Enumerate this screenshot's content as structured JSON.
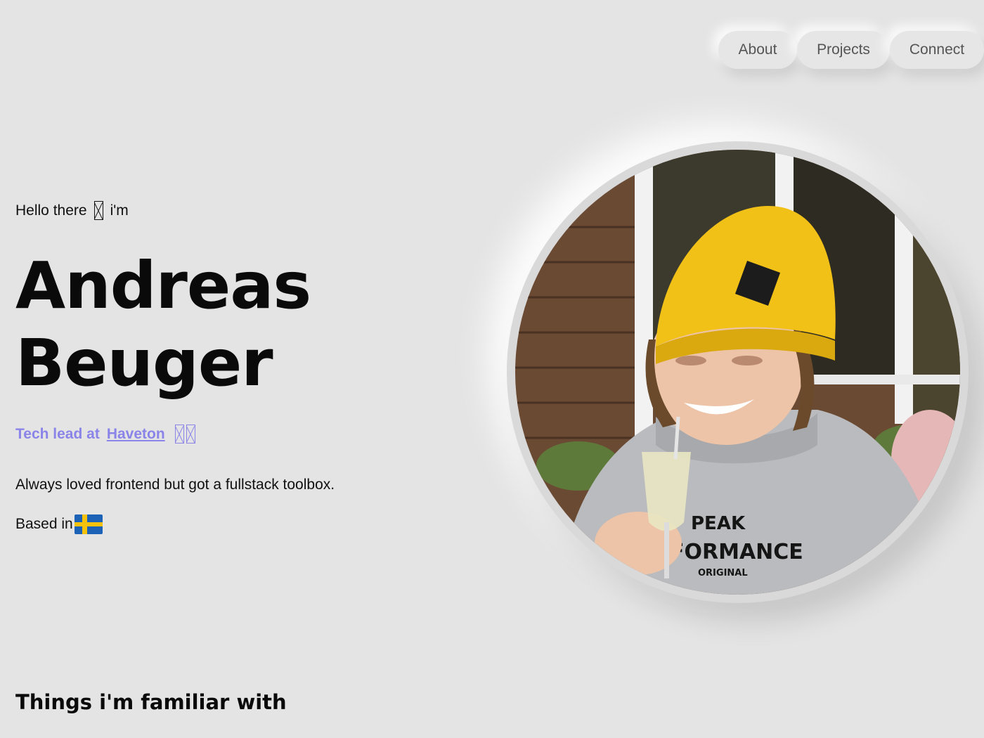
{
  "nav": {
    "items": [
      {
        "label": "About"
      },
      {
        "label": "Projects"
      },
      {
        "label": "Connect"
      }
    ]
  },
  "hero": {
    "greeting_before": "Hello there",
    "greeting_after": "i'm",
    "name_first": "Andreas",
    "name_last": "Beuger",
    "role_prefix": "Tech lead at",
    "company": "Haveton",
    "tagline": "Always loved frontend but got a fullstack toolbox.",
    "based_in": "Based in",
    "flag_icon": "sweden-flag-icon",
    "accent_color": "#8a84e8"
  },
  "portrait": {
    "hoodie_text_line1": "PEAK",
    "hoodie_text_line2": "FORMANCE",
    "hoodie_text_line3": "ORIGINAL"
  },
  "skills": {
    "title": "Things i'm familiar with"
  }
}
